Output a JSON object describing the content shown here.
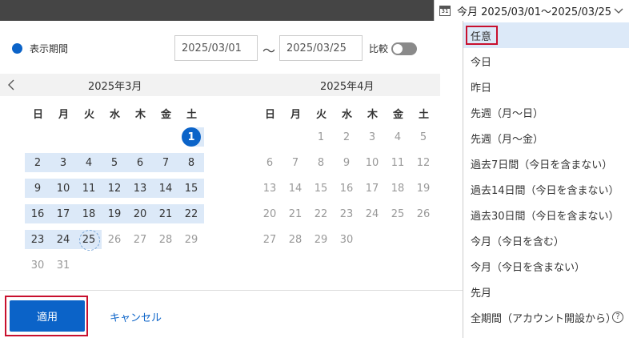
{
  "topbar": {
    "range_label": "今月 2025/03/01〜2025/03/25",
    "calendar_icon_text": "31"
  },
  "legend": {
    "label": "表示期間"
  },
  "dates": {
    "start": "2025/03/01",
    "end": "2025/03/25",
    "separator": "〜",
    "compare_label": "比較",
    "compare_on": false
  },
  "calendars": [
    {
      "title": "2025年3月"
    },
    {
      "title": "2025年4月"
    }
  ],
  "weekdays": [
    "日",
    "月",
    "火",
    "水",
    "木",
    "金",
    "土"
  ],
  "actions": {
    "apply": "適用",
    "cancel": "キャンセル"
  },
  "presets": [
    "任意",
    "今日",
    "昨日",
    "先週（月〜日）",
    "先週（月〜金）",
    "過去7日間（今日を含まない）",
    "過去14日間（今日を含まない）",
    "過去30日間（今日を含まない）",
    "今月（今日を含む）",
    "今月（今日を含まない）",
    "先月",
    "全期間（アカウント開設から）"
  ],
  "help_icon": "?",
  "colors": {
    "accent": "#0b63c8",
    "selection": "#dce9f8",
    "highlight": "#c8102e",
    "topbar": "#454545"
  }
}
